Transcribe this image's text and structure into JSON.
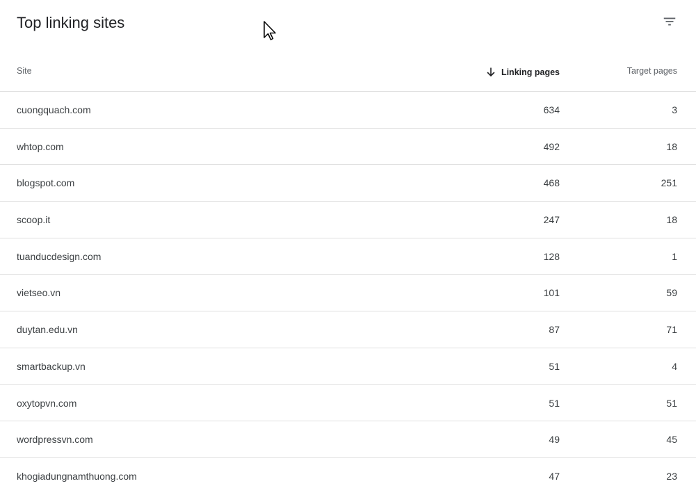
{
  "header": {
    "title": "Top linking sites",
    "filter_icon": "filter-list-icon"
  },
  "table": {
    "columns": {
      "site": "Site",
      "linking_pages": "Linking pages",
      "target_pages": "Target pages"
    },
    "sort": {
      "column": "linking_pages",
      "direction": "descending",
      "icon": "arrow-down-icon"
    },
    "rows": [
      {
        "site": "cuongquach.com",
        "linking_pages": "634",
        "target_pages": "3"
      },
      {
        "site": "whtop.com",
        "linking_pages": "492",
        "target_pages": "18"
      },
      {
        "site": "blogspot.com",
        "linking_pages": "468",
        "target_pages": "251"
      },
      {
        "site": "scoop.it",
        "linking_pages": "247",
        "target_pages": "18"
      },
      {
        "site": "tuanducdesign.com",
        "linking_pages": "128",
        "target_pages": "1"
      },
      {
        "site": "vietseo.vn",
        "linking_pages": "101",
        "target_pages": "59"
      },
      {
        "site": "duytan.edu.vn",
        "linking_pages": "87",
        "target_pages": "71"
      },
      {
        "site": "smartbackup.vn",
        "linking_pages": "51",
        "target_pages": "4"
      },
      {
        "site": "oxytopvn.com",
        "linking_pages": "51",
        "target_pages": "51"
      },
      {
        "site": "wordpressvn.com",
        "linking_pages": "49",
        "target_pages": "45"
      },
      {
        "site": "khogiadungnamthuong.com",
        "linking_pages": "47",
        "target_pages": "23"
      }
    ]
  },
  "colors": {
    "text_primary": "#202124",
    "text_secondary": "#5f6368",
    "divider": "#e0e0e0"
  }
}
